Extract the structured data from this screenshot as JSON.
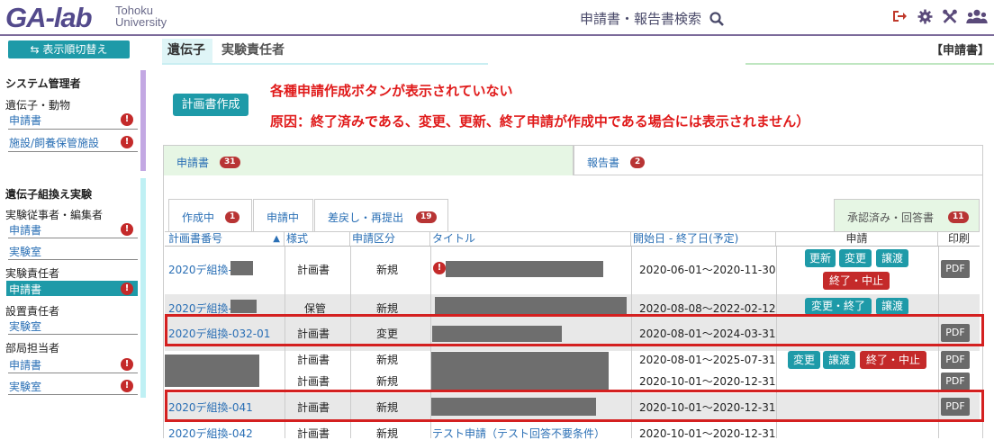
{
  "header": {
    "logo": "GA-lab",
    "logo_sub1": "Tohoku",
    "logo_sub2": "University",
    "search_label": "申請書・報告書検索",
    "icons": [
      "logout-icon",
      "gear-icon",
      "tools-icon",
      "users-icon"
    ]
  },
  "toolbar": {
    "reorder_label": "表示順切替え",
    "category": "遺伝子",
    "role": "実験責任者",
    "doc_type": "【申請書】"
  },
  "sidebar": {
    "section1_title": "システム管理者",
    "section1_sub": "遺伝子・動物",
    "section1_items": [
      "申請書",
      "施設/飼養保管施設"
    ],
    "section2_title": "遺伝子組換え実験",
    "groups": [
      {
        "label": "実験従事者・編集者",
        "items": [
          "申請書",
          "実験室"
        ]
      },
      {
        "label": "実験責任者",
        "items": [
          "申請書"
        ]
      },
      {
        "label": "設置責任者",
        "items": [
          "実験室"
        ]
      },
      {
        "label": "部局担当者",
        "items": [
          "申請書",
          "実験室"
        ]
      }
    ],
    "alert_symbol": "!"
  },
  "main": {
    "create_button": "計画書作成",
    "notice_line1": "各種申請作成ボタンが表示されていない",
    "notice_line2": "原因：終了済みである、変更、更新、終了申請が作成中である場合には表示されません）",
    "tabs": [
      {
        "label": "申請書",
        "count": "31"
      },
      {
        "label": "報告書",
        "count": "2"
      }
    ],
    "subtabs": [
      {
        "label": "作成中",
        "count": "1"
      },
      {
        "label": "申請中",
        "count": ""
      },
      {
        "label": "差戻し・再提出",
        "count": "19"
      },
      {
        "label": "承認済み・回答書",
        "count": "11"
      }
    ],
    "columns": [
      "計画書番号",
      "様式",
      "申請区分",
      "タイトル",
      "開始日 - 終了日(予定)",
      "申請",
      "印刷"
    ],
    "sort_arrow": "▲",
    "rows": [
      {
        "id": "2020デ組換-",
        "form": "計画書",
        "kind": "新規",
        "dates": "2020-06-01～2020-11-30",
        "actions": [
          "更新",
          "変更",
          "譲渡",
          "終了・中止"
        ]
      },
      {
        "id": "2020デ組換-",
        "form": "保管",
        "kind": "新規",
        "dates": "2020-08-08～2022-02-12",
        "actions": [
          "変更・終了",
          "譲渡"
        ]
      },
      {
        "id": "2020デ組換-032-01",
        "form": "計画書",
        "kind": "変更",
        "dates": "2020-08-01～2024-03-31",
        "actions": []
      },
      {
        "id": "",
        "form": "計画書",
        "kind": "新規",
        "dates": "2020-08-01～2025-07-31",
        "actions": [
          "変更",
          "譲渡",
          "終了・中止"
        ]
      },
      {
        "id": "",
        "form": "計画書",
        "kind": "新規",
        "dates": "2020-10-01～2020-12-31",
        "actions": []
      },
      {
        "id": "2020デ組換-041",
        "form": "計画書",
        "kind": "新規",
        "dates": "2020-10-01～2020-12-31",
        "actions": []
      },
      {
        "id": "2020デ組換-042",
        "form": "計画書",
        "kind": "新規",
        "title": "テスト申請（テスト回答不要条件）",
        "dates": "2020-10-01～2020-12-31",
        "actions": []
      }
    ],
    "pdf_label": "PDF"
  },
  "colors": {
    "accent": "#1e9aa8",
    "danger": "#c42a2a",
    "notice": "#e01b1b",
    "link": "#2a6fb5",
    "brand": "#534a8c"
  }
}
